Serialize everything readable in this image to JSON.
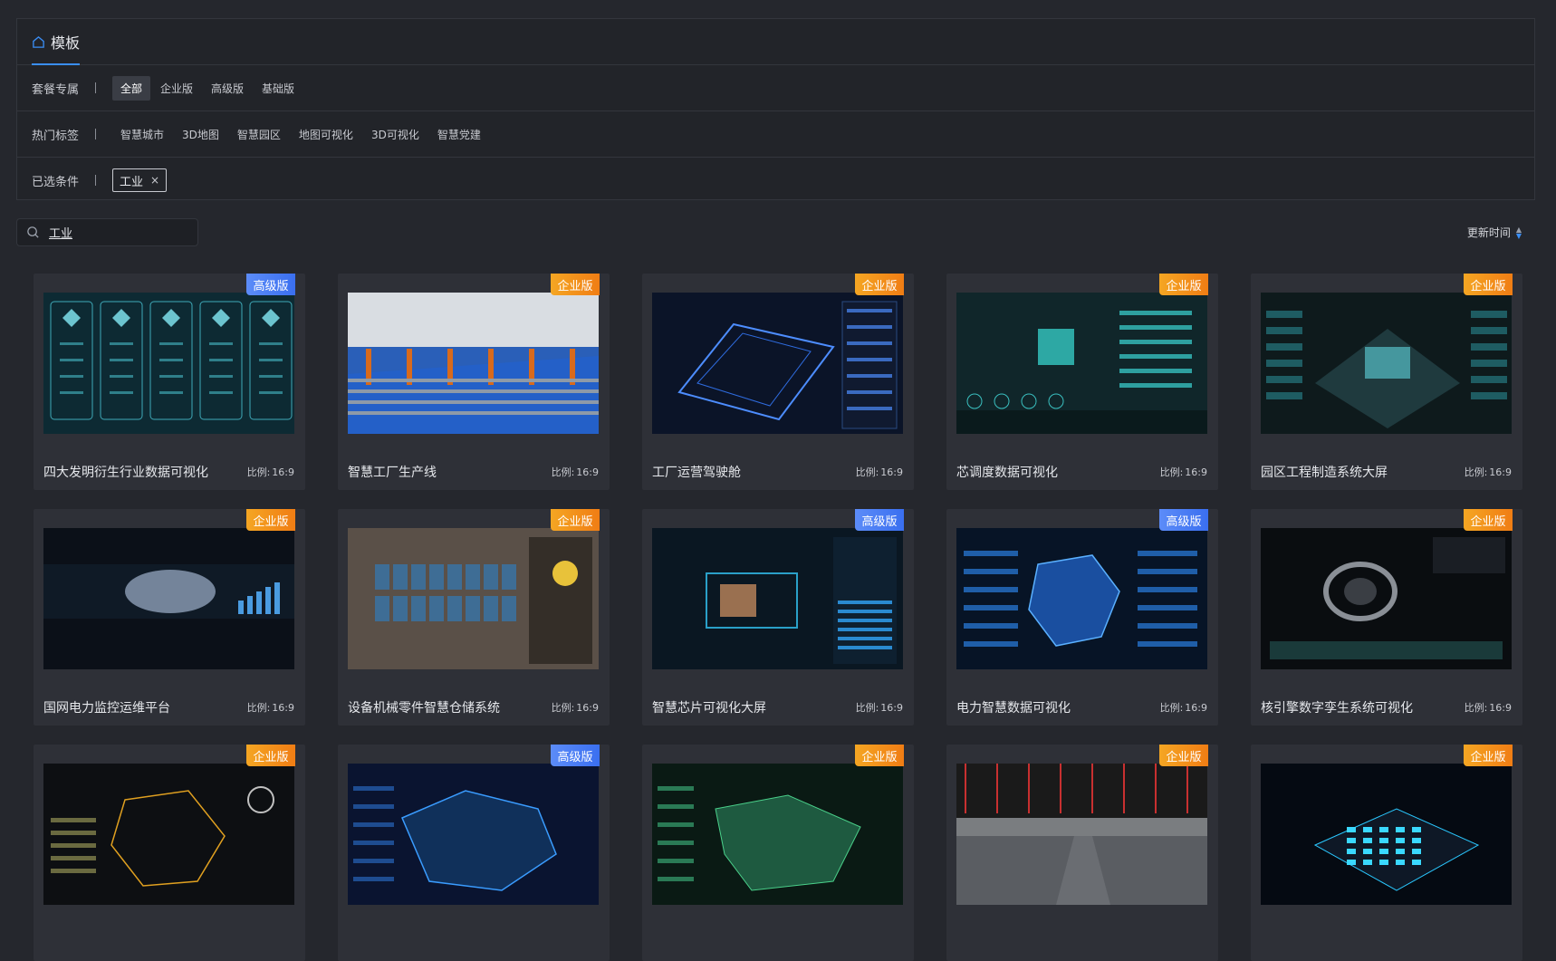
{
  "header": {
    "title": "模板"
  },
  "filters": {
    "plan": {
      "label": "套餐专属",
      "options": [
        "全部",
        "企业版",
        "高级版",
        "基础版"
      ],
      "active": 0
    },
    "hot": {
      "label": "热门标签",
      "options": [
        "智慧城市",
        "3D地图",
        "智慧园区",
        "地图可视化",
        "3D可视化",
        "智慧党建"
      ]
    },
    "selected": {
      "label": "已选条件",
      "chip": "工业",
      "close": "×"
    }
  },
  "search": {
    "value": "工业"
  },
  "sort": {
    "label": "更新时间"
  },
  "ratio_label": "比例:",
  "cards": [
    {
      "title": "四大发明衍生行业数据可视化",
      "badge": "高级版",
      "ratio": "16:9",
      "theme": "teal-panels"
    },
    {
      "title": "智慧工厂生产线",
      "badge": "企业版",
      "ratio": "16:9",
      "theme": "factory"
    },
    {
      "title": "工厂运营驾驶舱",
      "badge": "企业版",
      "ratio": "16:9",
      "theme": "blueprint"
    },
    {
      "title": "芯调度数据可视化",
      "badge": "企业版",
      "ratio": "16:9",
      "theme": "chip"
    },
    {
      "title": "园区工程制造系统大屏",
      "badge": "企业版",
      "ratio": "16:9",
      "theme": "campus"
    },
    {
      "title": "国网电力监控运维平台",
      "badge": "企业版",
      "ratio": "16:9",
      "theme": "power-map"
    },
    {
      "title": "设备机械零件智慧仓储系统",
      "badge": "企业版",
      "ratio": "16:9",
      "theme": "warehouse"
    },
    {
      "title": "智慧芯片可视化大屏",
      "badge": "高级版",
      "ratio": "16:9",
      "theme": "chip2"
    },
    {
      "title": "电力智慧数据可视化",
      "badge": "高级版",
      "ratio": "16:9",
      "theme": "province"
    },
    {
      "title": "核引擎数字孪生系统可视化",
      "badge": "企业版",
      "ratio": "16:9",
      "theme": "engine"
    },
    {
      "title": "",
      "badge": "企业版",
      "ratio": "",
      "theme": "gold-map"
    },
    {
      "title": "",
      "badge": "高级版",
      "ratio": "",
      "theme": "china-blue"
    },
    {
      "title": "",
      "badge": "企业版",
      "ratio": "",
      "theme": "green-map"
    },
    {
      "title": "",
      "badge": "企业版",
      "ratio": "",
      "theme": "parking"
    },
    {
      "title": "",
      "badge": "企业版",
      "ratio": "",
      "theme": "datacenter"
    }
  ],
  "colors": {
    "accent": "#3a8ef6",
    "enterprise": "#f07d14",
    "advanced": "#3a6ff0"
  }
}
